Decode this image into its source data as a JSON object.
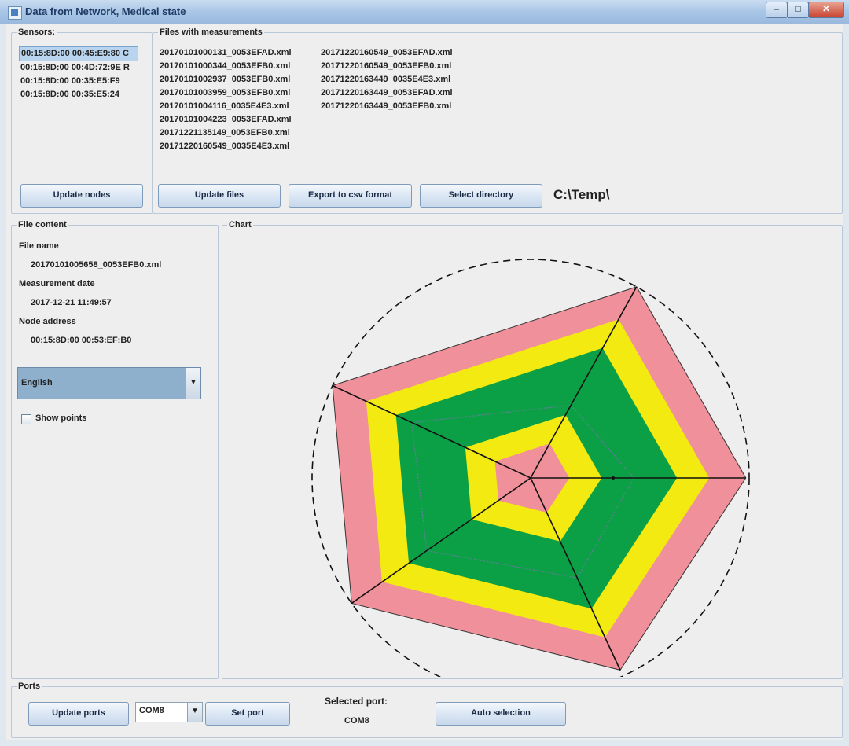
{
  "window": {
    "title": "Data from Network, Medical state"
  },
  "sensors": {
    "legend": "Sensors:",
    "items": [
      "00:15:8D:00 00:45:E9:80 C",
      "00:15:8D:00 00:4D:72:9E R",
      "00:15:8D:00 00:35:E5:F9",
      "00:15:8D:00 00:35:E5:24"
    ],
    "selected_index": 0,
    "update_button": "Update nodes"
  },
  "files": {
    "legend": "Files with measurements",
    "column1": [
      "20170101000131_0053EFAD.xml",
      "20170101000344_0053EFB0.xml",
      "20170101002937_0053EFB0.xml",
      "20170101003959_0053EFB0.xml",
      "20170101004116_0035E4E3.xml",
      "20170101004223_0053EFAD.xml",
      "20171221135149_0053EFB0.xml",
      "20171220160549_0035E4E3.xml"
    ],
    "column2": [
      "20171220160549_0053EFAD.xml",
      "20171220160549_0053EFB0.xml",
      "20171220163449_0035E4E3.xml",
      "20171220163449_0053EFAD.xml",
      "20171220163449_0053EFB0.xml"
    ],
    "update_button": "Update files",
    "export_button": "Export to csv format",
    "select_dir_button": "Select directory",
    "directory": "C:\\Temp\\"
  },
  "file_content": {
    "legend": "File content",
    "file_name_label": "File name",
    "file_name": "20170101005658_0053EFB0.xml",
    "date_label": "Measurement date",
    "date": "2017-12-21  11:49:57",
    "node_label": "Node address",
    "node": "00:15:8D:00 00:53:EF:B0",
    "language": "English",
    "show_points_label": "Show points",
    "show_points_checked": false
  },
  "chart": {
    "legend": "Chart",
    "chart_data": {
      "type": "radar",
      "axes": 5,
      "bands_outer_to_inner": [
        {
          "name": "",
          "color": "#f0909a",
          "level": 1.0
        },
        {
          "name": "",
          "color": "#f2ea10",
          "level": 0.83
        },
        {
          "name": "",
          "color": "#0ca046",
          "level": 0.68
        },
        {
          "name": "",
          "color": "#f2ea10",
          "level": 0.33
        },
        {
          "name": "",
          "color": "#f0909a",
          "level": 0.18
        }
      ],
      "dotted_series": [
        0.38,
        0.48,
        0.52,
        0.58,
        0.6
      ],
      "outer_circle": "dashed"
    }
  },
  "ports": {
    "legend": "Ports",
    "update_button": "Update ports",
    "port_value": "COM8",
    "set_button": "Set port",
    "selected_label": "Selected port:",
    "selected_value": "COM8",
    "auto_button": "Auto selection"
  },
  "colors": {
    "accent": "#2a6fb0",
    "selection": "#b8d4ee",
    "combo_blue": "#8aa8c4"
  }
}
